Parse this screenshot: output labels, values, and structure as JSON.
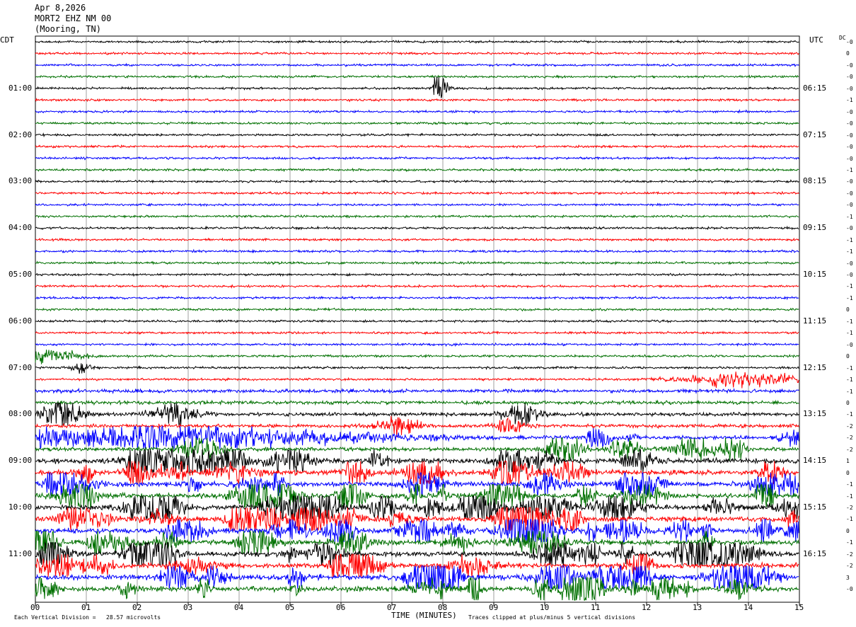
{
  "header": {
    "date": "Apr 8,2026",
    "station": "MORT2 EHZ NM 00",
    "location": "(Mooring, TN)"
  },
  "chart_data": {
    "type": "line",
    "description_tz_left": "CDT",
    "description_tz_right": "UTC",
    "dc_label": "DC",
    "xlabel": "TIME (MINUTES)",
    "x_ticks": [
      "00",
      "01",
      "02",
      "03",
      "04",
      "05",
      "06",
      "07",
      "08",
      "09",
      "10",
      "11",
      "12",
      "13",
      "14",
      "15"
    ],
    "xlim": [
      0,
      15
    ],
    "trace_count": 48,
    "trace_colors": [
      "#000000",
      "#ff0000",
      "#0000ff",
      "#007000"
    ],
    "left_hour_labels": [
      "01:00",
      "02:00",
      "03:00",
      "04:00",
      "05:00",
      "06:00",
      "07:00",
      "08:00",
      "09:00",
      "10:00",
      "11:00"
    ],
    "right_hour_labels": [
      "06:15",
      "07:15",
      "08:15",
      "09:15",
      "10:15",
      "11:15",
      "12:15",
      "13:15",
      "14:15",
      "15:15",
      "16:15"
    ],
    "dc_offsets": [
      "-0",
      "0",
      "-0",
      "-0",
      "-0",
      "-1",
      "-0",
      "-0",
      "-0",
      "-0",
      "-0",
      "-1",
      "-0",
      "-0",
      "-0",
      "-1",
      "-0",
      "-1",
      "-1",
      "-0",
      "-0",
      "-1",
      "-1",
      "0",
      "-1",
      "-1",
      "-0",
      "0",
      "-1",
      "-1",
      "-1",
      "0",
      "-1",
      "-2",
      "-2",
      "-2",
      "1",
      "0",
      "-1",
      "-1",
      "-2",
      "-1",
      "0",
      "-1",
      "-2",
      "-2",
      "3",
      "-0",
      "-0"
    ],
    "activity": [
      {
        "trace": 4,
        "minute": 7.95,
        "amp": 14,
        "width": 0.12
      },
      {
        "trace": 28,
        "minute": 0.9,
        "amp": 4,
        "width": 0.2
      },
      {
        "trace": 29,
        "minute": 14.0,
        "amp": 5,
        "width": 1.2
      },
      {
        "trace": 27,
        "minute": 0.2,
        "amp": 5,
        "width": 0.6
      },
      {
        "trace": 34,
        "minute": 3.0,
        "amp": 7,
        "width": 3.5
      },
      {
        "trace": 34,
        "minute": 14.9,
        "amp": 6,
        "width": 0.3
      },
      {
        "trace": 35,
        "minute": 10.3,
        "amp": 6,
        "width": 0.3
      },
      {
        "trace": 35,
        "minute": 12.9,
        "amp": 8,
        "width": 0.4
      }
    ],
    "heavy_start_trace": 36,
    "footer_left": "Each Vertical Division =   28.57 microvolts",
    "footer_right": "Traces clipped at plus/minus 5 vertical divisions"
  }
}
